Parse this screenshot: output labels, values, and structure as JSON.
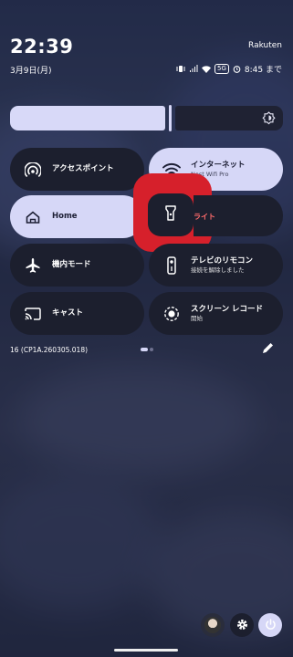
{
  "status": {
    "time": "22:39",
    "carrier": "Rakuten",
    "date": "3月9日(月)",
    "network_badge": "5G",
    "alarm": "8:45 まで"
  },
  "brightness": {
    "level_fraction": 0.57
  },
  "tiles": {
    "hotspot": {
      "label": "アクセスポイント",
      "icon": "hotspot-icon"
    },
    "internet": {
      "label": "インターネット",
      "sub": "Nest Wifi Pro",
      "icon": "wifi-icon"
    },
    "home": {
      "label": "Home",
      "icon": "home-icon"
    },
    "flashlight": {
      "label": "ライト",
      "icon": "flashlight-icon"
    },
    "airplane": {
      "label": "機内モード",
      "icon": "airplane-icon"
    },
    "remote": {
      "label": "テレビのリモコン",
      "sub": "接続を解除しました",
      "icon": "tv-remote-icon"
    },
    "cast": {
      "label": "キャスト",
      "icon": "cast-icon"
    },
    "screen_record": {
      "label": "スクリーン レコード",
      "sub": "開始",
      "icon": "screen-record-icon"
    }
  },
  "footer": {
    "build": "16 (CP1A.260305.018)",
    "page": 1,
    "pages": 2
  },
  "colors": {
    "accent": "#d6d7f7",
    "tile_dark": "#1c1f2e",
    "highlight": "#d6202b"
  }
}
